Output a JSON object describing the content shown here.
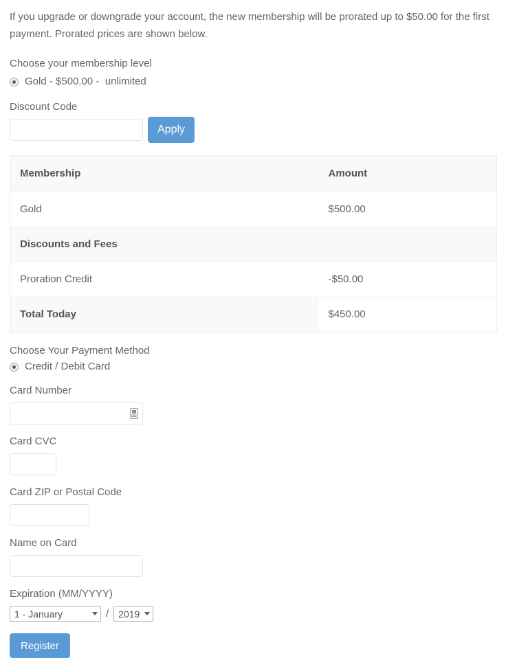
{
  "intro": {
    "text": "If you upgrade or downgrade your account, the new membership will be prorated up to $50.00 for the first payment. Prorated prices are shown below."
  },
  "membership": {
    "heading": "Choose your membership level",
    "options": [
      {
        "label": "Gold - $500.00 -  unlimited",
        "selected": true
      }
    ]
  },
  "discount": {
    "label": "Discount Code",
    "value": "",
    "placeholder": "",
    "apply_label": "Apply"
  },
  "pricing_table": {
    "columns": [
      "Membership",
      "Amount"
    ],
    "rows": [
      {
        "type": "item",
        "name": "Gold",
        "amount": "$500.00"
      },
      {
        "type": "section",
        "name": "Discounts and Fees",
        "amount": ""
      },
      {
        "type": "item",
        "name": "Proration Credit",
        "amount": "-$50.00"
      },
      {
        "type": "total",
        "name": "Total Today",
        "amount": "$450.00"
      }
    ]
  },
  "payment": {
    "heading": "Choose Your Payment Method",
    "methods": [
      {
        "label": "Credit / Debit Card",
        "selected": true
      }
    ],
    "fields": {
      "card_number": {
        "label": "Card Number",
        "value": "",
        "placeholder": "",
        "icon": "credit-card-autofill-icon"
      },
      "card_cvc": {
        "label": "Card CVC",
        "value": "",
        "placeholder": ""
      },
      "card_zip": {
        "label": "Card ZIP or Postal Code",
        "value": "",
        "placeholder": ""
      },
      "name_on_card": {
        "label": "Name on Card",
        "value": "",
        "placeholder": ""
      },
      "expiration": {
        "label": "Expiration (MM/YYYY)",
        "separator": "/",
        "month": {
          "selected": "1 - January"
        },
        "year": {
          "selected": "2019"
        }
      }
    }
  },
  "submit": {
    "register_label": "Register"
  },
  "colors": {
    "accent_blue": "#5b9bd5",
    "text": "#5c6670",
    "heading": "#4b545c",
    "table_stripe": "#f9f9f9",
    "border": "#ececec"
  }
}
